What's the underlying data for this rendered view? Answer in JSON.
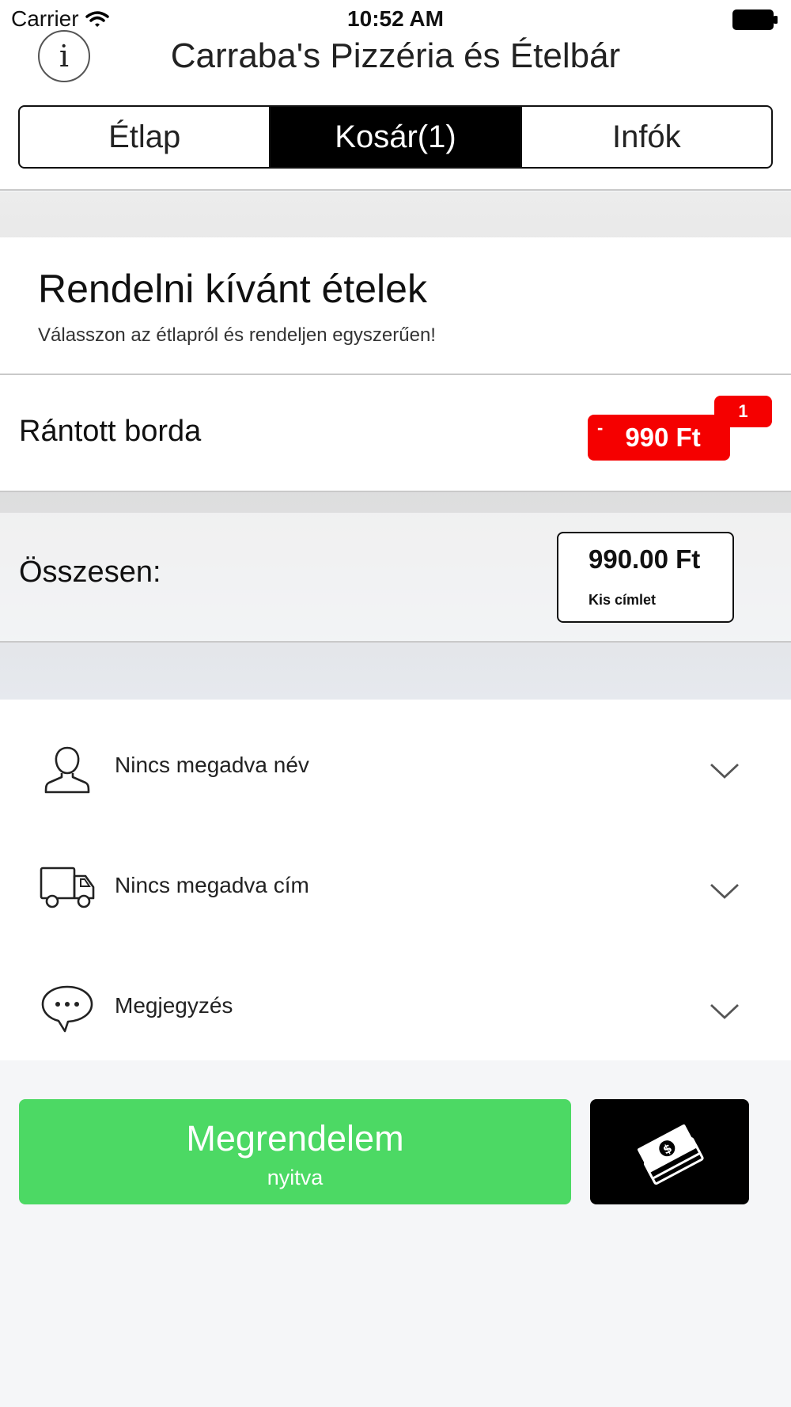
{
  "status_bar": {
    "carrier": "Carrier",
    "time": "10:52 AM"
  },
  "header": {
    "info_label": "i",
    "title": "Carraba's Pizzéria és Ételbár"
  },
  "tabs": [
    {
      "label": "Étlap",
      "active": false
    },
    {
      "label": "Kosár(1)",
      "active": true
    },
    {
      "label": "Infók",
      "active": false
    }
  ],
  "cart": {
    "title": "Rendelni kívánt ételek",
    "subtitle": "Válasszon az étlapról és rendeljen egyszerűen!",
    "items": [
      {
        "name": "Rántott borda",
        "minus": "-",
        "price": "990 Ft",
        "quantity": "1"
      }
    ],
    "total_label": "Összesen:",
    "total_amount": "990.00 Ft",
    "payment_note": "Kis címlet"
  },
  "form": {
    "name": {
      "label": "Nincs megadva név",
      "icon": "user-icon"
    },
    "address": {
      "label": "Nincs megadva cím",
      "icon": "truck-icon"
    },
    "note": {
      "label": "Megjegyzés",
      "icon": "speech-bubble-icon"
    }
  },
  "actions": {
    "order_label": "Megrendelem",
    "order_status": "nyitva",
    "payment_icon": "cash-icon"
  },
  "colors": {
    "accent_red": "#f50000",
    "order_green": "#4cd964",
    "active_tab": "#000000"
  }
}
